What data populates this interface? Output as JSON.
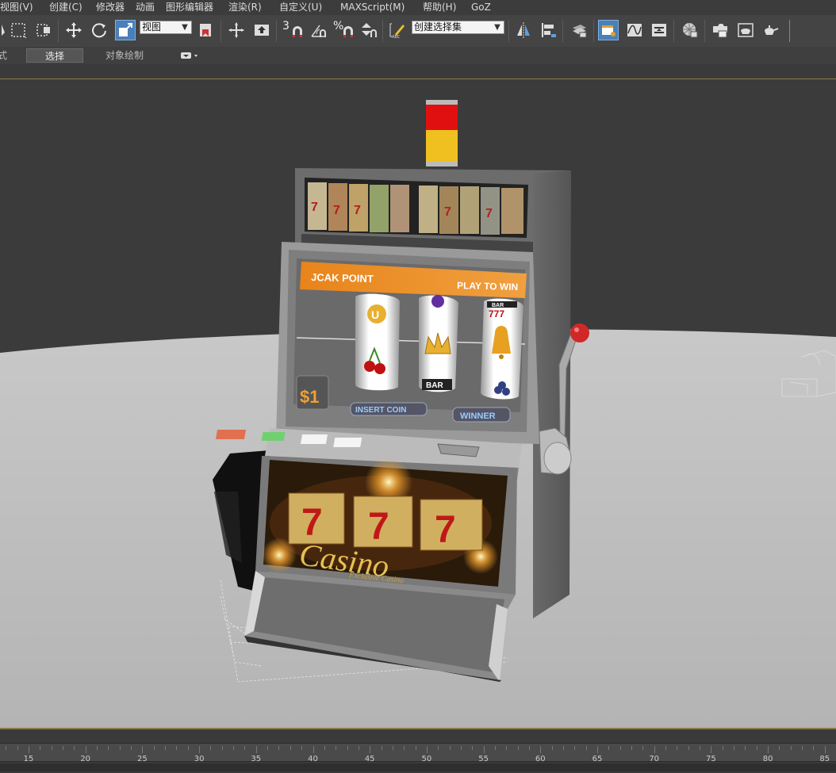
{
  "menubar": {
    "items": [
      {
        "label": "视图(V)"
      },
      {
        "label": "创建(C)"
      },
      {
        "label": "修改器"
      },
      {
        "label": "动画"
      },
      {
        "label": "图形编辑器"
      },
      {
        "label": "渲染(R)"
      },
      {
        "label": "自定义(U)"
      },
      {
        "label": "MAXScript(M)"
      },
      {
        "label": "帮助(H)"
      },
      {
        "label": "GoZ"
      }
    ]
  },
  "toolbar": {
    "view_dropdown": "视图",
    "selection_set_dropdown": "创建选择集",
    "snap_number": "3",
    "percent_symbol": "%",
    "icons": [
      "rect-select-icon",
      "window-crossing-icon",
      "move-icon",
      "rotate-icon",
      "scale-icon",
      "pivot-icon",
      "manipulate-icon",
      "keyboard-shortcut-icon",
      "snap-toggle-icon",
      "angle-snap-icon",
      "percent-snap-icon",
      "spinner-snap-icon",
      "edit-named-selection-icon",
      "mirror-icon",
      "align-icon",
      "layer-manager-icon",
      "scene-explorer-icon",
      "curve-editor-icon",
      "schematic-view-icon",
      "material-editor-icon",
      "render-setup-icon",
      "rendered-frame-icon",
      "render-icon"
    ]
  },
  "ribbon": {
    "left_fragment": "式",
    "tabs": [
      {
        "label": "选择",
        "active": true
      },
      {
        "label": "对象绘制",
        "active": false
      }
    ]
  },
  "viewport": {
    "slot_machine": {
      "top_label_left": "JCAK POINT",
      "top_label_right": "PLAY TO WIN",
      "price_label": "$1",
      "insert_label": "INSERT COIN",
      "winner_label": "WINNER",
      "reel_bar_label": "BAR",
      "reel_777_label": "777",
      "casino_text": "Casino",
      "casino_subtext": "Exclusive Casino",
      "sevens": [
        "7",
        "7",
        "7"
      ]
    },
    "colors": {
      "background": "#3b3b3b",
      "floor": "#bcbcbc",
      "cabinet": "#6e6e6e",
      "light_red": "#e01010",
      "light_yellow": "#f0c020",
      "banner_orange": "#e8841a"
    }
  },
  "timeline": {
    "ticks": [
      15,
      20,
      25,
      30,
      35,
      40,
      45,
      50,
      55,
      60,
      65,
      70,
      75,
      80,
      85
    ]
  }
}
